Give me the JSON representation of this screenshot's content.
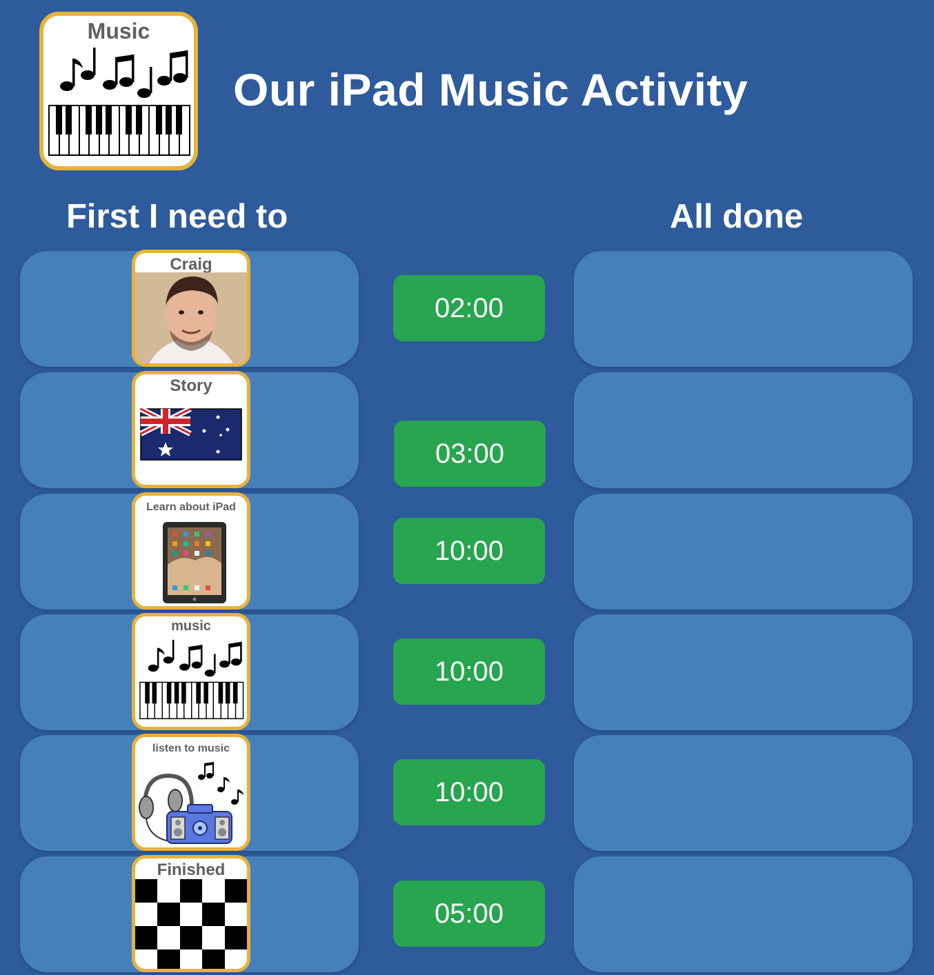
{
  "header": {
    "icon_label": "Music",
    "title": "Our iPad Music Activity"
  },
  "columns": {
    "first": "First I need to",
    "done": "All done"
  },
  "tasks": [
    {
      "label": "Craig",
      "icon": "person-photo-icon",
      "timer": "02:00"
    },
    {
      "label": "Story",
      "icon": "australian-flag-icon",
      "timer": "03:00"
    },
    {
      "label": "Learn about iPad",
      "icon": "ipad-icon",
      "timer": "10:00"
    },
    {
      "label": "music",
      "icon": "music-keyboard-icon",
      "timer": "10:00"
    },
    {
      "label": "listen to music",
      "icon": "headphones-boombox-icon",
      "timer": "10:00"
    },
    {
      "label": "Finished",
      "icon": "checkered-flag-icon",
      "timer": "05:00"
    }
  ],
  "colors": {
    "background": "#2e5b9b",
    "slot": "#4580ba",
    "card_border": "#e8b23a",
    "timer": "#27a54f"
  }
}
